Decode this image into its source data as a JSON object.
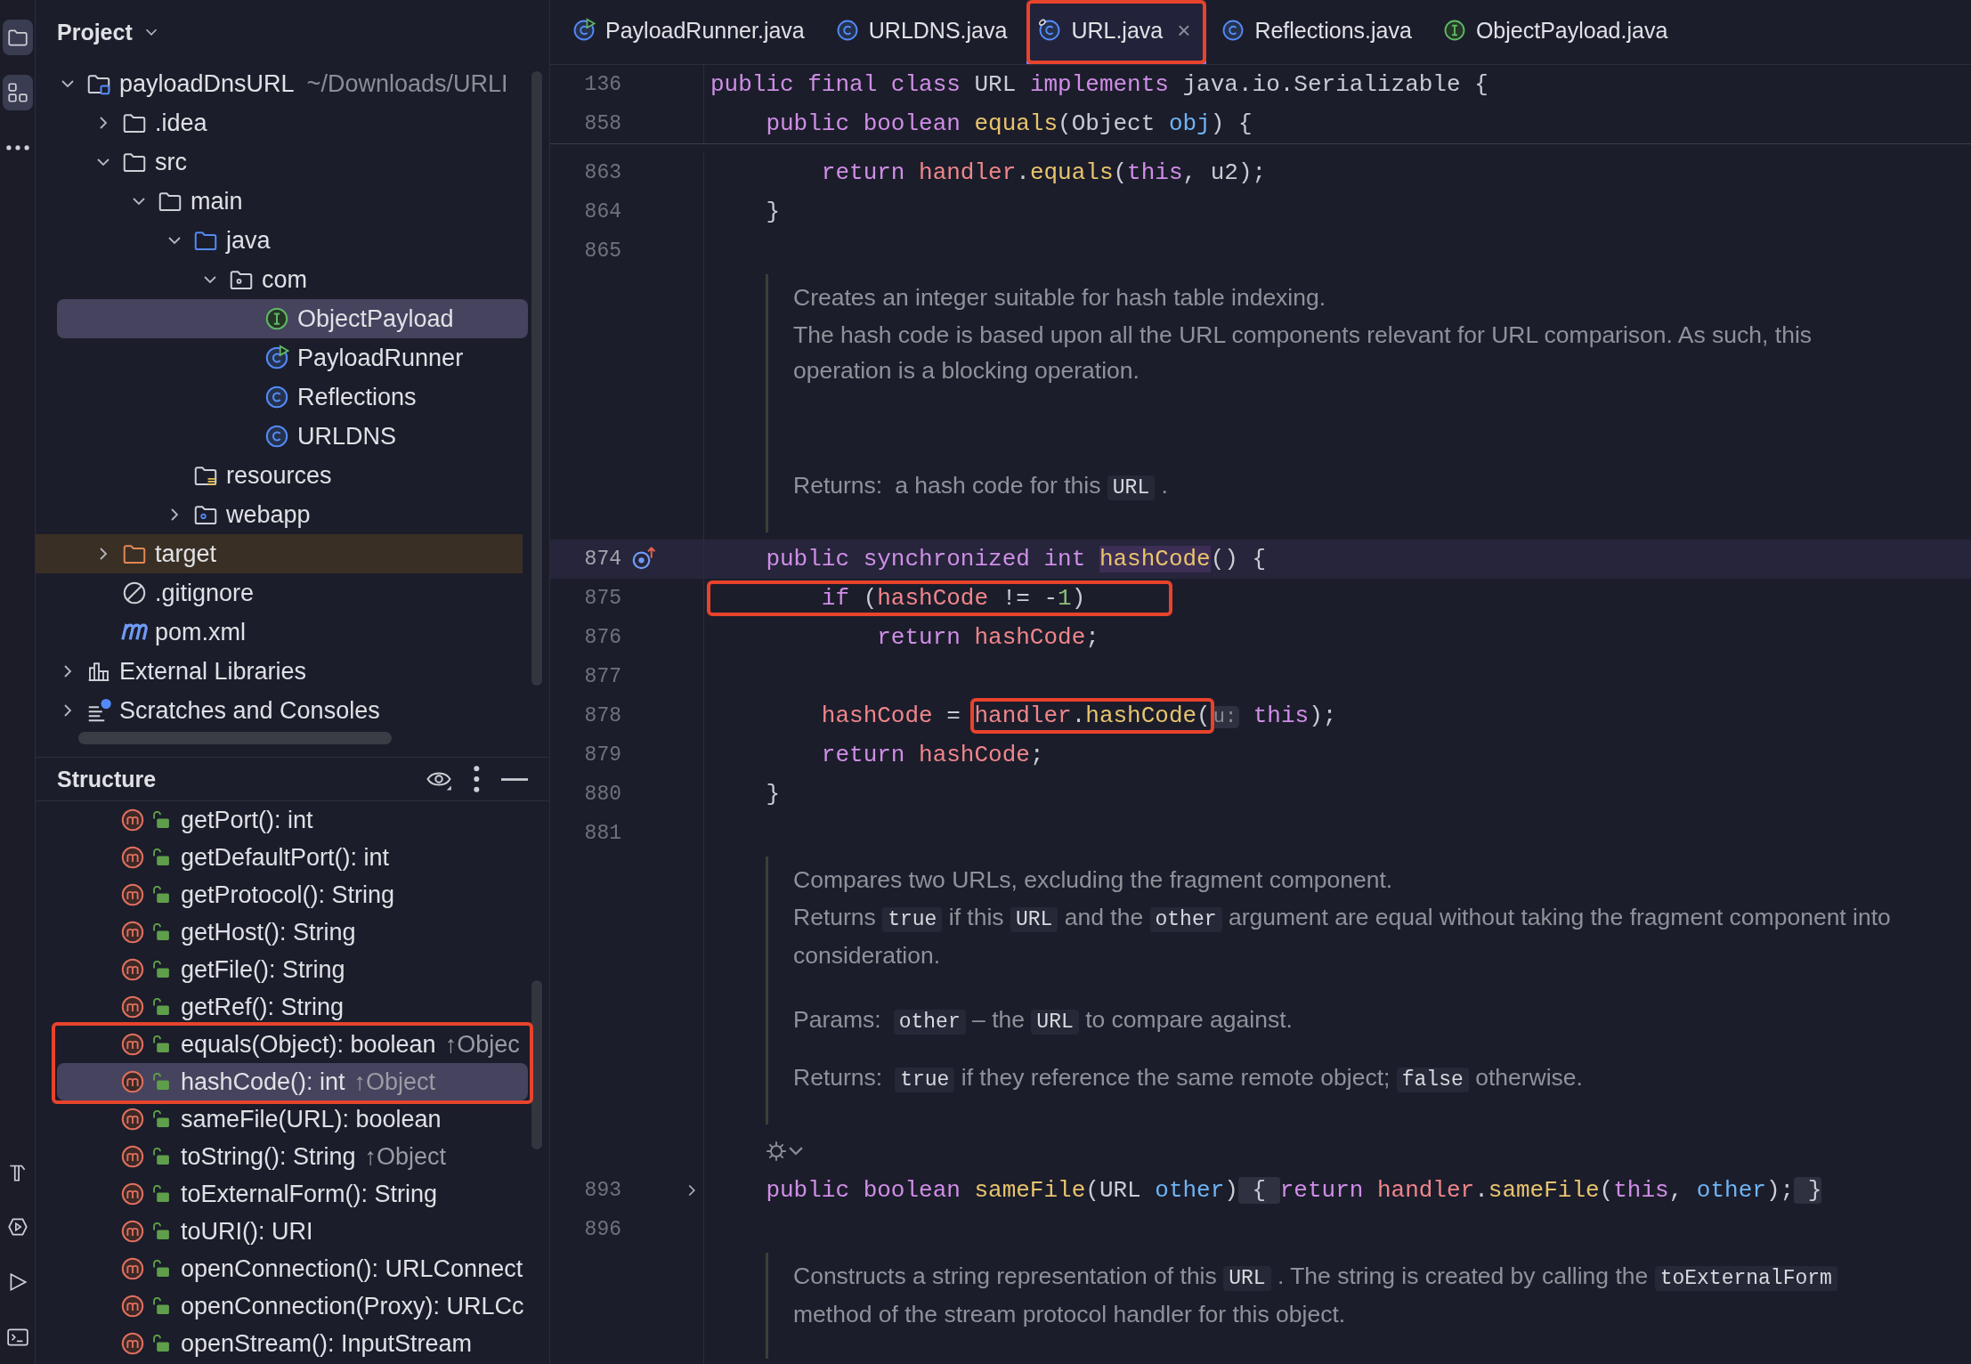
{
  "tool_strip": {
    "top": [
      {
        "kind": "project",
        "selected": true
      },
      {
        "kind": "structure",
        "selected": true
      },
      {
        "kind": "more",
        "selected": false
      }
    ],
    "bottom": [
      {
        "kind": "build",
        "selected": false
      },
      {
        "kind": "services",
        "selected": false
      },
      {
        "kind": "run",
        "selected": false
      },
      {
        "kind": "terminal",
        "selected": false
      }
    ]
  },
  "project_panel": {
    "title": "Project",
    "tree": [
      {
        "label": "payloadDnsURL",
        "path": "~/Downloads/URLI",
        "kind": "project",
        "expanded": true,
        "selected": false,
        "children": [
          {
            "label": ".idea",
            "kind": "folder",
            "expanded": false,
            "selected": false
          },
          {
            "label": "src",
            "kind": "folder",
            "expanded": true,
            "selected": false,
            "children": [
              {
                "label": "main",
                "kind": "folder",
                "expanded": true,
                "selected": false,
                "children": [
                  {
                    "label": "java",
                    "kind": "source-folder",
                    "expanded": true,
                    "selected": false,
                    "children": [
                      {
                        "label": "com",
                        "kind": "package",
                        "expanded": true,
                        "selected": false,
                        "children": [
                          {
                            "label": "ObjectPayload",
                            "kind": "interface",
                            "selected": true
                          },
                          {
                            "label": "PayloadRunner",
                            "kind": "runnable-class",
                            "selected": false
                          },
                          {
                            "label": "Reflections",
                            "kind": "class",
                            "selected": false
                          },
                          {
                            "label": "URLDNS",
                            "kind": "class",
                            "selected": false
                          }
                        ]
                      }
                    ]
                  },
                  {
                    "label": "resources",
                    "kind": "resources",
                    "selected": false
                  },
                  {
                    "label": "webapp",
                    "kind": "webapp",
                    "expanded": false,
                    "selected": false
                  }
                ]
              }
            ]
          },
          {
            "label": "target",
            "kind": "excluded-folder",
            "expanded": false,
            "selected": false
          },
          {
            "label": ".gitignore",
            "kind": "gitignore",
            "selected": false
          },
          {
            "label": "pom.xml",
            "kind": "maven",
            "selected": false
          }
        ]
      },
      {
        "label": "External Libraries",
        "kind": "libraries",
        "expanded": false,
        "selected": false
      },
      {
        "label": "Scratches and Consoles",
        "kind": "scratches",
        "expanded": false,
        "selected": false
      }
    ]
  },
  "structure_panel": {
    "title": "Structure",
    "items": [
      {
        "label": "getPort(): int",
        "selected": false,
        "annotated": false
      },
      {
        "label": "getDefaultPort(): int",
        "selected": false,
        "annotated": false
      },
      {
        "label": "getProtocol(): String",
        "selected": false,
        "annotated": false
      },
      {
        "label": "getHost(): String",
        "selected": false,
        "annotated": false
      },
      {
        "label": "getFile(): String",
        "selected": false,
        "annotated": false
      },
      {
        "label": "getRef(): String",
        "selected": false,
        "annotated": false
      },
      {
        "label": "equals(Object): boolean",
        "inherited": "↑Objec",
        "selected": false,
        "annotated": true
      },
      {
        "label": "hashCode(): int",
        "inherited": "↑Object",
        "selected": true,
        "annotated": true
      },
      {
        "label": "sameFile(URL): boolean",
        "selected": false,
        "annotated": false
      },
      {
        "label": "toString(): String",
        "inherited": "↑Object",
        "selected": false,
        "annotated": false
      },
      {
        "label": "toExternalForm(): String",
        "selected": false,
        "annotated": false
      },
      {
        "label": "toURI(): URI",
        "selected": false,
        "annotated": false
      },
      {
        "label": "openConnection(): URLConnect",
        "selected": false,
        "annotated": false
      },
      {
        "label": "openConnection(Proxy): URLCc",
        "selected": false,
        "annotated": false
      },
      {
        "label": "openStream(): InputStream",
        "selected": false,
        "annotated": false
      }
    ]
  },
  "editor": {
    "tabs": [
      {
        "label": "PayloadRunner.java",
        "kind": "runnable-class",
        "selected": false,
        "annotated": false
      },
      {
        "label": "URLDNS.java",
        "kind": "class",
        "selected": false,
        "annotated": false
      },
      {
        "label": "URL.java",
        "kind": "library-class",
        "selected": true,
        "annotated": true,
        "close": "×"
      },
      {
        "label": "Reflections.java",
        "kind": "class",
        "selected": false,
        "annotated": false
      },
      {
        "label": "ObjectPayload.java",
        "kind": "interface",
        "selected": false,
        "annotated": false
      }
    ],
    "sticky_lines": [
      {
        "number": "136",
        "current": false,
        "tokens": [
          {
            "kind": "kw",
            "text": "public final class "
          },
          {
            "kind": "plain",
            "text": "URL "
          },
          {
            "kind": "kw",
            "text": "implements "
          },
          {
            "kind": "plain",
            "text": "java.io.Serializable {"
          }
        ]
      },
      {
        "number": "858",
        "current": false,
        "tokens": [
          {
            "kind": "kw",
            "text": "    public boolean "
          },
          {
            "kind": "fn",
            "text": "equals"
          },
          {
            "kind": "plain",
            "text": "(Object "
          },
          {
            "kind": "param",
            "text": "obj"
          },
          {
            "kind": "plain",
            "text": ") {"
          }
        ]
      }
    ],
    "blocks": [
      {
        "kind": "code",
        "number": "863",
        "current": false,
        "tokens": [
          {
            "kind": "kw",
            "text": "        return "
          },
          {
            "kind": "field",
            "text": "handler"
          },
          {
            "kind": "plain",
            "text": "."
          },
          {
            "kind": "fn",
            "text": "equals"
          },
          {
            "kind": "plain",
            "text": "("
          },
          {
            "kind": "kw",
            "text": "this"
          },
          {
            "kind": "plain",
            "text": ", u2);"
          }
        ]
      },
      {
        "kind": "code",
        "number": "864",
        "current": false,
        "tokens": [
          {
            "kind": "plain",
            "text": "    }"
          }
        ]
      },
      {
        "kind": "code",
        "number": "865",
        "current": false
      },
      {
        "kind": "doc",
        "paragraphs": [
          {
            "kind": "text",
            "segments": [
              {
                "kind": "text",
                "text": "Creates an integer suitable for hash table indexing."
              }
            ]
          },
          {
            "kind": "text",
            "segments": [
              {
                "kind": "text",
                "text": "The hash code is based upon all the URL components relevant for URL comparison. As such, this operation is a blocking operation."
              }
            ]
          },
          {
            "kind": "tag",
            "label": "Returns:",
            "segments": [
              {
                "kind": "text",
                "text": "a hash code for this "
              },
              {
                "kind": "code",
                "text": "URL"
              },
              {
                "kind": "text",
                "text": " ."
              }
            ]
          }
        ]
      },
      {
        "kind": "code",
        "number": "874",
        "current": true,
        "overridden": true,
        "tokens": [
          {
            "kind": "kw",
            "text": "    public synchronized int "
          },
          {
            "kind": "hl",
            "text": "hashCode"
          },
          {
            "kind": "plain",
            "text": "() {"
          }
        ]
      },
      {
        "kind": "code",
        "number": "875",
        "current": false,
        "tokens": [
          {
            "kind": "kw",
            "text": "        if ",
            "annotated": true
          },
          {
            "kind": "plain",
            "text": "(",
            "annotated": true
          },
          {
            "kind": "field",
            "text": "hashCode",
            "annotated": true
          },
          {
            "kind": "plain",
            "text": " != -",
            "annotated": true
          },
          {
            "kind": "num",
            "text": "1",
            "annotated": true
          },
          {
            "kind": "plain",
            "text": ")      ",
            "annotated": true
          }
        ]
      },
      {
        "kind": "code",
        "number": "876",
        "current": false,
        "tokens": [
          {
            "kind": "kw",
            "text": "            return "
          },
          {
            "kind": "field",
            "text": "hashCode"
          },
          {
            "kind": "plain",
            "text": ";"
          }
        ]
      },
      {
        "kind": "code",
        "number": "877",
        "current": false
      },
      {
        "kind": "code",
        "number": "878",
        "current": false,
        "tokens": [
          {
            "kind": "field",
            "text": "        hashCode"
          },
          {
            "kind": "plain",
            "text": " = "
          },
          {
            "kind": "field",
            "text": "handler",
            "annotated": true
          },
          {
            "kind": "plain",
            "text": ".",
            "annotated": true
          },
          {
            "kind": "fn",
            "text": "hashCode",
            "annotated": true
          },
          {
            "kind": "plain",
            "text": "(",
            "annotated": true
          },
          {
            "kind": "hint",
            "text": "u:"
          },
          {
            "kind": "kw",
            "text": " this"
          },
          {
            "kind": "plain",
            "text": ");"
          }
        ]
      },
      {
        "kind": "code",
        "number": "879",
        "current": false,
        "tokens": [
          {
            "kind": "kw",
            "text": "        return "
          },
          {
            "kind": "field",
            "text": "hashCode"
          },
          {
            "kind": "plain",
            "text": ";"
          }
        ]
      },
      {
        "kind": "code",
        "number": "880",
        "current": false,
        "tokens": [
          {
            "kind": "plain",
            "text": "    }"
          }
        ]
      },
      {
        "kind": "code",
        "number": "881",
        "current": false
      },
      {
        "kind": "doc",
        "paragraphs": [
          {
            "kind": "text",
            "segments": [
              {
                "kind": "text",
                "text": "Compares two URLs, excluding the fragment component."
              }
            ]
          },
          {
            "kind": "text",
            "segments": [
              {
                "kind": "text",
                "text": "Returns "
              },
              {
                "kind": "code",
                "text": "true"
              },
              {
                "kind": "text",
                "text": " if this "
              },
              {
                "kind": "code",
                "text": "URL"
              },
              {
                "kind": "text",
                "text": " and the "
              },
              {
                "kind": "code",
                "text": "other"
              },
              {
                "kind": "text",
                "text": " argument are equal without taking the fragment component into consideration."
              }
            ]
          },
          {
            "kind": "tag",
            "label": "Params:",
            "segments": [
              {
                "kind": "code",
                "text": "other"
              },
              {
                "kind": "text",
                "text": " – the "
              },
              {
                "kind": "code",
                "text": "URL"
              },
              {
                "kind": "text",
                "text": " to compare against."
              }
            ]
          },
          {
            "kind": "tag",
            "label": "Returns:",
            "segments": [
              {
                "kind": "code",
                "text": "true"
              },
              {
                "kind": "text",
                "text": " if they reference the same remote object; "
              },
              {
                "kind": "code",
                "text": "false"
              },
              {
                "kind": "text",
                "text": " otherwise."
              }
            ]
          }
        ]
      },
      {
        "kind": "toggle"
      },
      {
        "kind": "code",
        "number": "893",
        "current": false,
        "folded": true,
        "tokens": [
          {
            "kind": "kw",
            "text": "    public boolean "
          },
          {
            "kind": "fn",
            "text": "sameFile"
          },
          {
            "kind": "plain",
            "text": "(URL "
          },
          {
            "kind": "param",
            "text": "other"
          },
          {
            "kind": "plain",
            "text": ")"
          },
          {
            "kind": "fold",
            "text": " { "
          },
          {
            "kind": "kw",
            "text": "return "
          },
          {
            "kind": "field",
            "text": "handler"
          },
          {
            "kind": "plain",
            "text": "."
          },
          {
            "kind": "fn",
            "text": "sameFile"
          },
          {
            "kind": "plain",
            "text": "("
          },
          {
            "kind": "kw",
            "text": "this"
          },
          {
            "kind": "plain",
            "text": ", "
          },
          {
            "kind": "param",
            "text": "other"
          },
          {
            "kind": "plain",
            "text": ");"
          },
          {
            "kind": "fold",
            "text": " }"
          }
        ]
      },
      {
        "kind": "code",
        "number": "896",
        "current": false
      },
      {
        "kind": "doc",
        "paragraphs": [
          {
            "kind": "text",
            "segments": [
              {
                "kind": "text",
                "text": "Constructs a string representation of this "
              },
              {
                "kind": "code",
                "text": "URL"
              },
              {
                "kind": "text",
                "text": " . The string is created by calling the "
              },
              {
                "kind": "code",
                "text": "toExternalForm"
              },
              {
                "kind": "text",
                "text": " method of the stream protocol handler for this object."
              }
            ]
          }
        ]
      }
    ]
  }
}
